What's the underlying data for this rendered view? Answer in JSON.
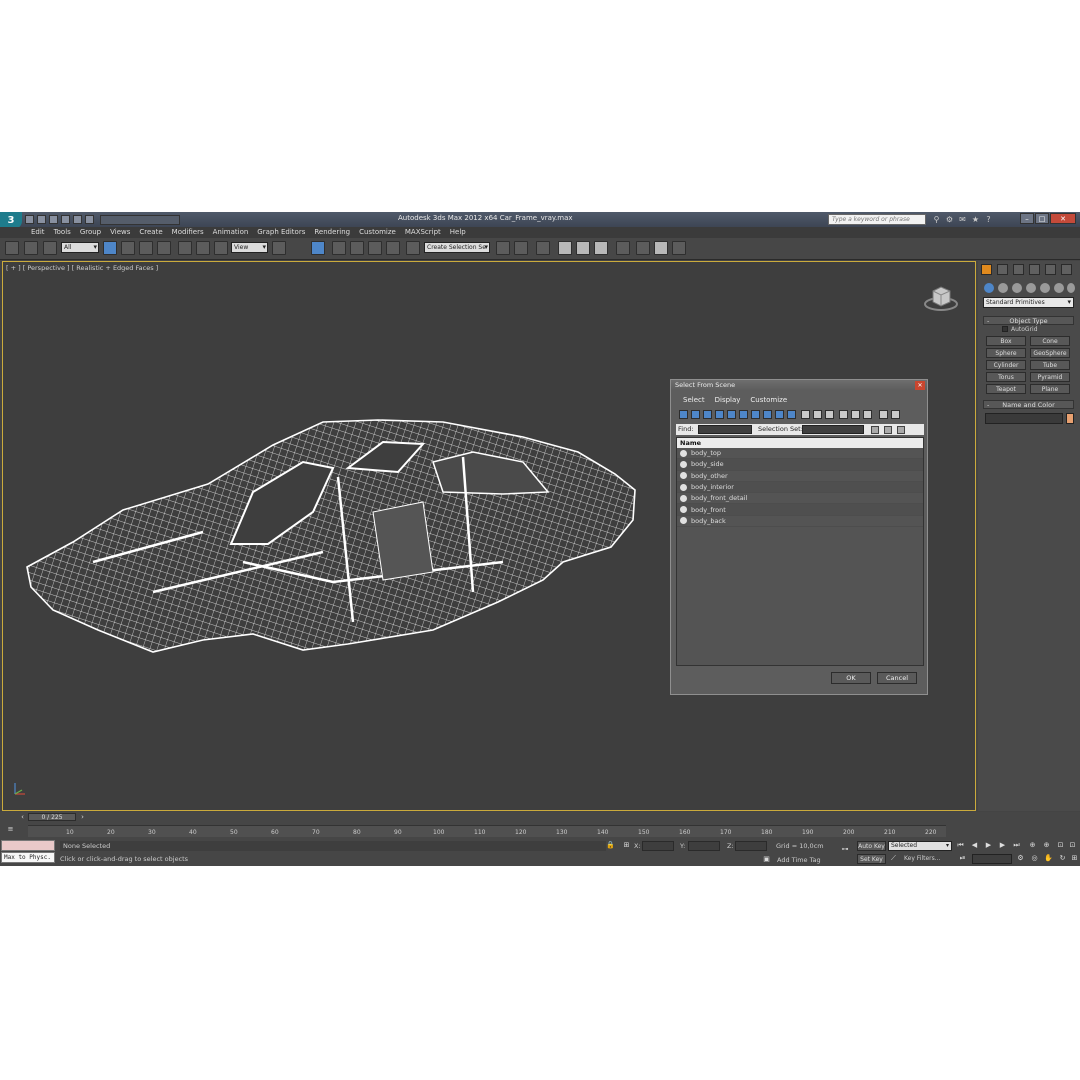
{
  "app": {
    "title": "Autodesk 3ds Max  2012 x64     Car_Frame_vray.max",
    "help_search_placeholder": "Type a keyword or phrase"
  },
  "menu": [
    "Edit",
    "Tools",
    "Group",
    "Views",
    "Create",
    "Modifiers",
    "Animation",
    "Graph Editors",
    "Rendering",
    "Customize",
    "MAXScript",
    "Help"
  ],
  "toolbar": {
    "filter_value": "All",
    "reference_coord": "View",
    "selection_set": "Create Selection Se"
  },
  "viewport": {
    "label": "[ + ] [ Perspective ] [ Realistic + Edged Faces ]"
  },
  "command_panel": {
    "category": "Standard Primitives",
    "object_type_title": "Object Type",
    "autogrid": "AutoGrid",
    "buttons": [
      "Box",
      "Cone",
      "Sphere",
      "GeoSphere",
      "Cylinder",
      "Tube",
      "Torus",
      "Pyramid",
      "Teapot",
      "Plane"
    ],
    "name_color_title": "Name and Color",
    "swatch_color": "#e8a070"
  },
  "dialog": {
    "title": "Select From Scene",
    "menu": [
      "Select",
      "Display",
      "Customize"
    ],
    "find_label": "Find:",
    "selection_set_label": "Selection Set:",
    "column_name": "Name",
    "items": [
      "body_top",
      "body_side",
      "body_other",
      "body_interior",
      "body_front_detail",
      "body_front",
      "body_back"
    ],
    "ok": "OK",
    "cancel": "Cancel"
  },
  "timeline": {
    "frame": "0 / 225",
    "ticks": [
      "10",
      "20",
      "30",
      "40",
      "50",
      "60",
      "70",
      "80",
      "90",
      "100",
      "110",
      "120",
      "130",
      "140",
      "150",
      "160",
      "170",
      "180",
      "190",
      "200",
      "210",
      "220"
    ]
  },
  "status": {
    "maxscript": "Max to Physc.",
    "selection": "None Selected",
    "prompt": "Click or click-and-drag to select objects",
    "x_label": "X:",
    "y_label": "Y:",
    "z_label": "Z:",
    "grid": "Grid = 10,0cm",
    "add_time_tag": "Add Time Tag",
    "auto_key": "Auto Key",
    "set_key": "Set Key",
    "selected": "Selected",
    "key_filters": "Key Filters..."
  },
  "colors": {
    "accent": "#4e86c8",
    "viewport_border": "#cbab3c",
    "create_tab": "#e08a1e"
  }
}
